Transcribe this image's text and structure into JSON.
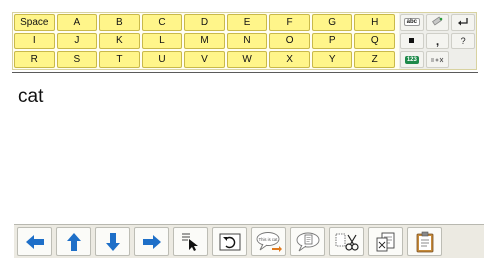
{
  "keyboard": {
    "letters": [
      "Space",
      "A",
      "B",
      "C",
      "D",
      "E",
      "F",
      "G",
      "H",
      "I",
      "J",
      "K",
      "L",
      "M",
      "N",
      "O",
      "P",
      "Q",
      "R",
      "S",
      "T",
      "U",
      "V",
      "W",
      "X",
      "Y",
      "Z"
    ],
    "side": {
      "abc_label": "abc",
      "numbers_label": "123",
      "comma": ",",
      "question": "?"
    },
    "key_color": "#fff58a"
  },
  "document": {
    "text": "cat"
  },
  "toolbar": {
    "speak_bubble_label": "This is cat",
    "icons": [
      "arrow-left-icon",
      "arrow-up-icon",
      "arrow-down-icon",
      "arrow-right-icon",
      "select-cursor-icon",
      "undo-icon",
      "speak-sentence-icon",
      "speak-bubble-icon",
      "scissors-icon",
      "paste-icon",
      "clipboard-icon"
    ],
    "arrow_color": "#1e6fc8"
  }
}
